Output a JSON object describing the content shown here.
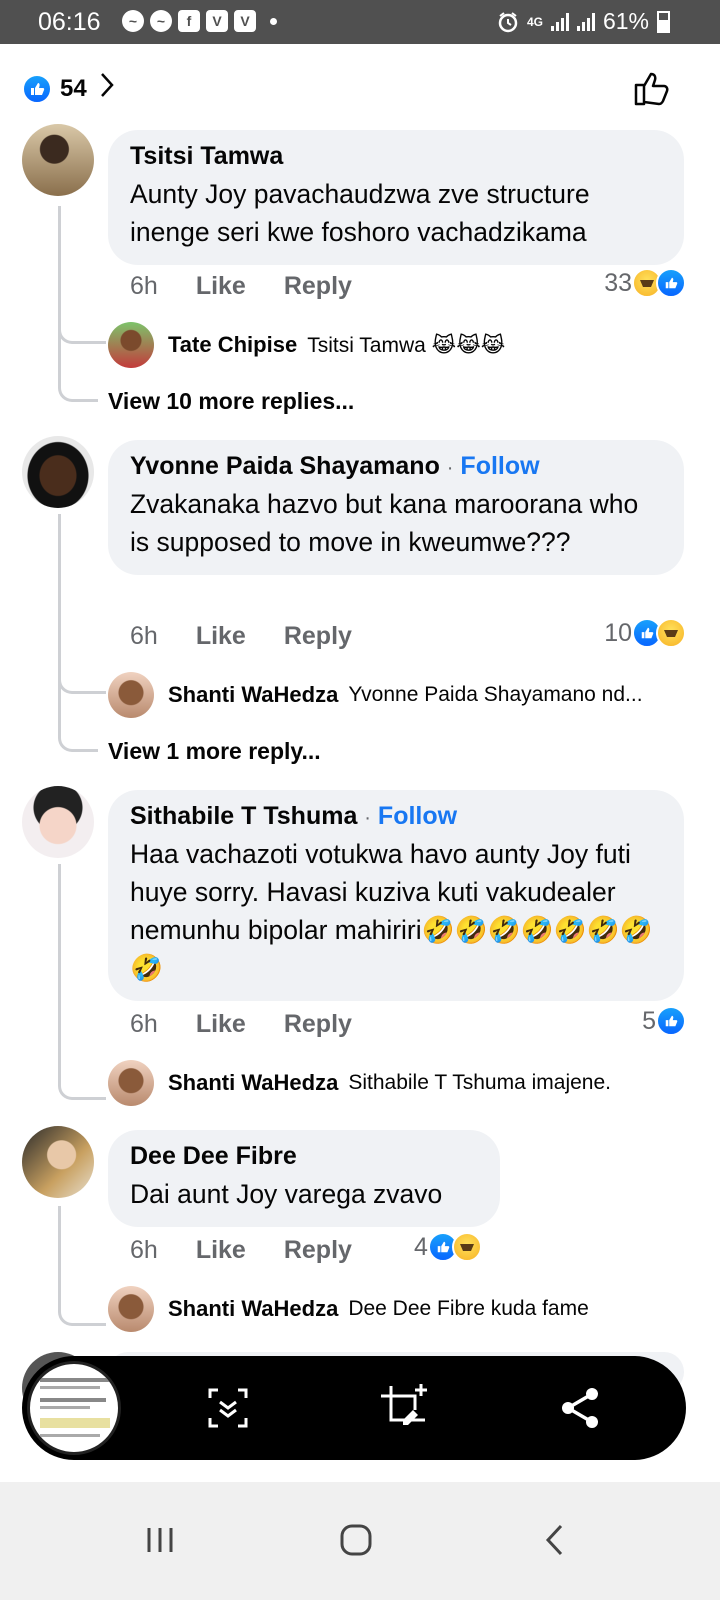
{
  "status_bar": {
    "time": "06:16",
    "battery": "61%",
    "network": "4G",
    "battery_level": 0.61
  },
  "header": {
    "like_count": "54"
  },
  "comments": [
    {
      "author": "Tsitsi Tamwa",
      "follow": "",
      "text": "Aunty Joy pavachaudzwa zve structure inenge seri kwe foshoro vachadzikama",
      "time": "6h",
      "like_label": "Like",
      "reply_label": "Reply",
      "reaction_count": "33",
      "reply_preview": {
        "author": "Tate Chipise",
        "text": "Tsitsi Tamwa 😹😹😹"
      },
      "more_replies": "View 10 more replies..."
    },
    {
      "author": "Yvonne Paida Shayamano",
      "follow": "Follow",
      "text": "Zvakanaka hazvo but kana maroorana who is supposed to move in kweumwe???",
      "time": "6h",
      "like_label": "Like",
      "reply_label": "Reply",
      "reaction_count": "10",
      "reply_preview": {
        "author": "Shanti WaHedza",
        "text": "Yvonne Paida Shayamano nd..."
      },
      "more_replies": "View 1 more reply..."
    },
    {
      "author": "Sithabile T Tshuma",
      "follow": "Follow",
      "text": "Haa vachazoti votukwa havo aunty Joy futi huye sorry. Havasi kuziva kuti vakudealer nemunhu bipolar mahiriri🤣🤣🤣🤣🤣🤣🤣🤣",
      "time": "6h",
      "like_label": "Like",
      "reply_label": "Reply",
      "reaction_count": "5",
      "reply_preview": {
        "author": "Shanti WaHedza",
        "text": "Sithabile T Tshuma imajene."
      },
      "more_replies": ""
    },
    {
      "author": "Dee Dee Fibre",
      "follow": "",
      "text": "Dai aunt Joy varega zvavo",
      "time": "6h",
      "like_label": "Like",
      "reply_label": "Reply",
      "reaction_count": "4",
      "reply_preview": {
        "author": "Shanti WaHedza",
        "text": "Dee Dee Fibre kuda fame"
      },
      "more_replies": ""
    }
  ],
  "follow_separator": "·",
  "colors": {
    "accent": "#1877f2",
    "bubble": "#f0f2f5",
    "status_bar": "#505050"
  },
  "icons": {
    "header_like": "thumbs-up-outline-icon",
    "toolbar": [
      "scroll-capture-icon",
      "crop-edit-icon",
      "share-icon"
    ],
    "navigation": [
      "recents-icon",
      "home-icon",
      "back-icon"
    ]
  }
}
